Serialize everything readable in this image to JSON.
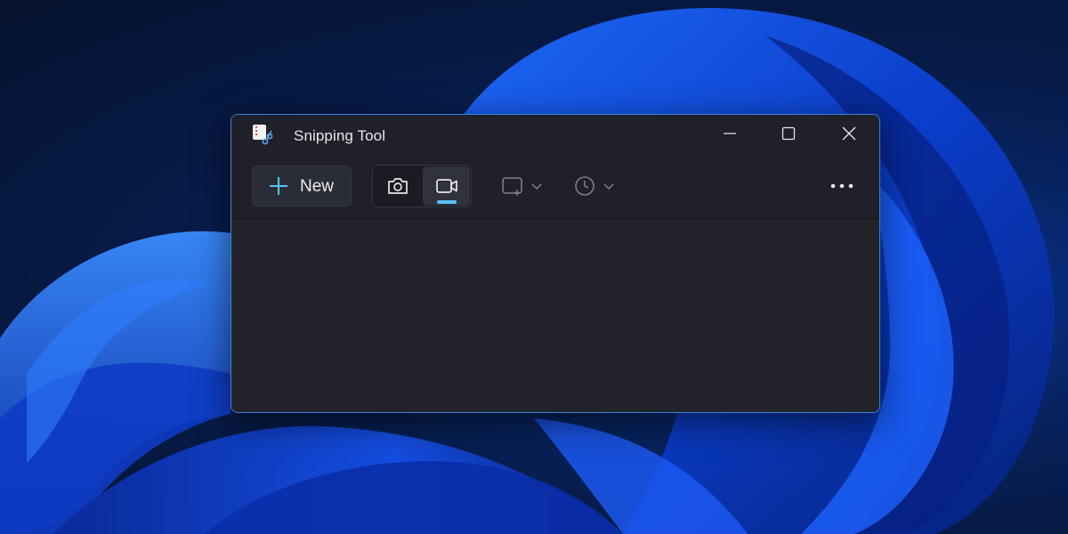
{
  "window": {
    "title": "Snipping Tool",
    "app_icon": "snipping-tool-app-icon"
  },
  "title_controls": {
    "minimize_icon": "minimize-icon",
    "maximize_icon": "maximize-icon",
    "close_icon": "close-icon"
  },
  "toolbar": {
    "new_label": "New",
    "new_icon": "plus-icon",
    "modes": [
      {
        "name": "snip",
        "icon": "camera-icon",
        "selected": false
      },
      {
        "name": "record",
        "icon": "video-camera-icon",
        "selected": true
      }
    ],
    "snip_shape_icon": "rectangle-snip-icon",
    "delay_icon": "clock-icon",
    "more_icon": "more-dots-icon"
  },
  "colors": {
    "accent": "#5cc0f5",
    "window_bg": "#202028",
    "border": "#3a83d8"
  }
}
